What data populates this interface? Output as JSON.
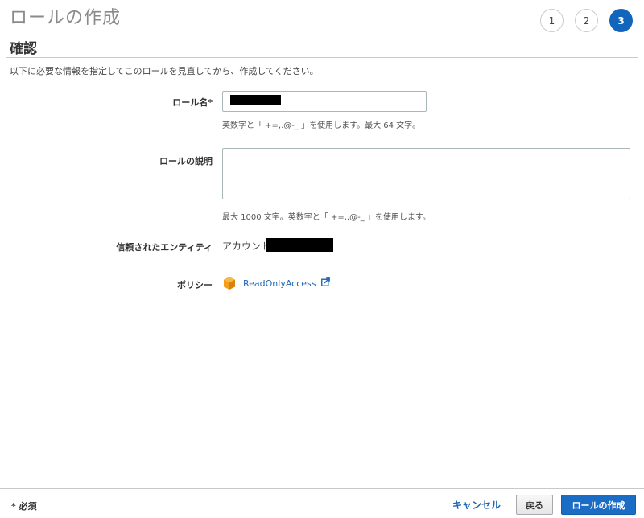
{
  "header": {
    "title": "ロールの作成",
    "steps": [
      "1",
      "2",
      "3"
    ],
    "active_step": "3"
  },
  "section": {
    "title": "確認",
    "intro": "以下に必要な情報を指定してこのロールを見直してから、作成してください。"
  },
  "form": {
    "role_name": {
      "label": "ロール名*",
      "value": "",
      "hint": "英数字と「 +=,.@-_ 」を使用します。最大 64 文字。"
    },
    "role_description": {
      "label": "ロールの説明",
      "value": "",
      "hint": "最大 1000 文字。英数字と「 +=,.@-_ 」を使用します。"
    },
    "trusted_entity": {
      "label": "信頼されたエンティティ",
      "value": "アカウント"
    },
    "policies": {
      "label": "ポリシー",
      "items": [
        {
          "name": "ReadOnlyAccess",
          "icon": "policy-cube-icon"
        }
      ]
    }
  },
  "footer": {
    "required_note": "* 必須",
    "cancel_label": "キャンセル",
    "back_label": "戻る",
    "create_label": "ロールの作成"
  },
  "colors": {
    "accent": "#1a6cc4",
    "link": "#1f67b4",
    "policy_icon": "#f59d1d"
  }
}
